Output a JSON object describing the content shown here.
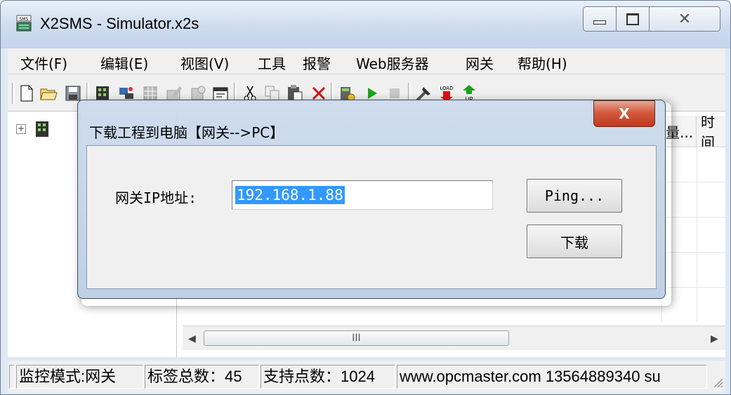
{
  "window": {
    "title": "X2SMS - Simulator.x2s",
    "icon": "sms-app-icon",
    "controls": {
      "minimize": "▭",
      "maximize": "▣",
      "close": "⨯"
    }
  },
  "menu": {
    "items": [
      "文件(F)",
      "编辑(E)",
      "视图(V)",
      "工具",
      "报警",
      "Web服务器",
      "网关",
      "帮助(H)"
    ]
  },
  "toolbar": {
    "icons": [
      "new-file-icon",
      "open-folder-icon",
      "save-icon",
      "gateway-icon",
      "connect-icon",
      "grid-icon",
      "edit-icon",
      "properties-icon",
      "settings-icon",
      "cut-icon",
      "copy-icon",
      "paste-icon",
      "delete-icon",
      "device-icon",
      "run-icon",
      "stop-icon",
      "tools-icon",
      "load-icon",
      "up-icon"
    ]
  },
  "tree": {
    "expander": "+"
  },
  "list": {
    "columns": [
      "量...",
      "时间"
    ]
  },
  "scroll": {
    "left": "◀",
    "right": "▶",
    "thumb": "III"
  },
  "status": {
    "mode": "监控模式:网关",
    "tag_count": "标签总数：45",
    "point_count": "支持点数：1024",
    "info": "www.opcmaster.com 13564889340 su"
  },
  "dialog": {
    "title": "下载工程到电脑【网关-->PC】",
    "close": "X",
    "ip_label": "网关IP地址:",
    "ip_value": "192.168.1.88",
    "ping_label": "Ping...",
    "download_label": "下载"
  }
}
